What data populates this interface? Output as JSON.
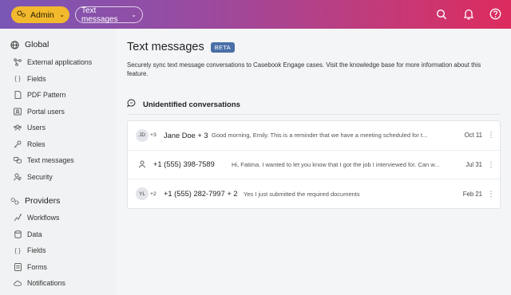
{
  "header": {
    "admin_label": "Admin",
    "section_label": "Text messages",
    "icons": [
      "search-icon",
      "bell-icon",
      "help-icon"
    ]
  },
  "sidebar": {
    "global": {
      "label": "Global",
      "items": [
        {
          "label": "External applications",
          "icon": "nodes-icon"
        },
        {
          "label": "Fields",
          "icon": "braces-icon"
        },
        {
          "label": "PDF Pattern",
          "icon": "document-icon"
        },
        {
          "label": "Portal users",
          "icon": "portal-users-icon"
        },
        {
          "label": "Users",
          "icon": "users-icon"
        },
        {
          "label": "Roles",
          "icon": "key-icon"
        },
        {
          "label": "Text messages",
          "icon": "chat-bubbles-icon"
        },
        {
          "label": "Security",
          "icon": "security-user-icon"
        }
      ]
    },
    "providers": {
      "label": "Providers",
      "items": [
        {
          "label": "Workflows",
          "icon": "workflow-icon"
        },
        {
          "label": "Data",
          "icon": "database-icon"
        },
        {
          "label": "Fields",
          "icon": "braces-icon"
        },
        {
          "label": "Forms",
          "icon": "form-icon"
        },
        {
          "label": "Notifications",
          "icon": "cloud-icon"
        }
      ]
    }
  },
  "main": {
    "title": "Text messages",
    "badge": "BETA",
    "description": "Securely sync text message conversations to Casebook Engage cases. Visit the knowledge base for more information about this feature.",
    "section_title": "Unidentified conversations",
    "conversations": [
      {
        "avatar": "JD",
        "extra": "+3",
        "name": "Jane Doe + 3",
        "preview": "Good morning, Emily. This is a reminder that we have a meeting scheduled for t...",
        "date": "Oct 11"
      },
      {
        "avatar": "",
        "extra": "",
        "name": "+1 (555) 398-7589",
        "preview": "Hi, Fatima. I wanted to let you know that I got the job I interviewed for. Can w...",
        "date": "Jul 31"
      },
      {
        "avatar": "YL",
        "extra": "+2",
        "name": "+1 (555) 282-7997 + 2",
        "preview": "Yes I just submitted the required documents",
        "date": "Feb 21"
      }
    ]
  },
  "colors": {
    "admin": "#f2b92d",
    "beta": "#4a6fa8",
    "header_start": "#7a57b5",
    "header_end": "#dd2b5e"
  }
}
